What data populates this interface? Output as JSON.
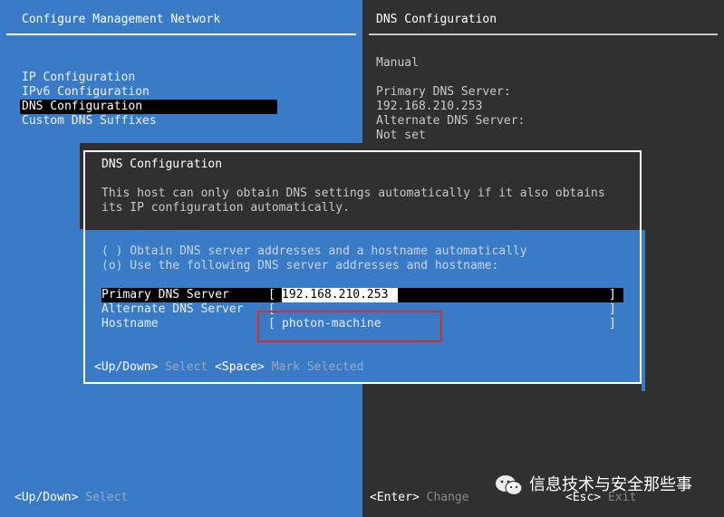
{
  "left_panel": {
    "title": "Configure Management Network",
    "menu": [
      {
        "label": "IP Configuration",
        "selected": false
      },
      {
        "label": "IPv6 Configuration",
        "selected": false
      },
      {
        "label": "DNS Configuration",
        "selected": true
      },
      {
        "label": "Custom DNS Suffixes",
        "selected": false
      }
    ],
    "footer_key": "<Up/Down>",
    "footer_action": "Select"
  },
  "right_panel": {
    "title": "DNS Configuration",
    "mode": "Manual",
    "primary_label": "Primary DNS Server:",
    "primary_value": "192.168.210.253",
    "alternate_label": "Alternate DNS Server:",
    "alternate_value": "Not set",
    "footer_enter_key": "<Enter>",
    "footer_enter_action": "Change",
    "footer_esc_key": "<Esc>",
    "footer_esc_action": "Exit"
  },
  "dialog": {
    "title": "DNS Configuration",
    "description_line1": "This host can only obtain DNS settings automatically if it also obtains",
    "description_line2": "its IP configuration automatically.",
    "option_auto": "( ) Obtain DNS server addresses and a hostname automatically",
    "option_manual": "(o) Use the following DNS server addresses and hostname:",
    "fields": {
      "primary_label": "Primary DNS Server",
      "primary_value": "192.168.210.253",
      "alternate_label": "Alternate DNS Server",
      "alternate_value": "",
      "hostname_label": "Hostname",
      "hostname_value": "photon-machine"
    },
    "bracket_open": "[",
    "bracket_close": "]",
    "footer_updown_key": "<Up/Down>",
    "footer_updown_action": "Select",
    "footer_space_key": "<Space>",
    "footer_space_action": "Mark Selected"
  },
  "watermark": {
    "text": "信息技术与安全那些事",
    "icon": "wechat-icon"
  },
  "colors": {
    "blue": "#3a7bc8",
    "dark": "#303030",
    "highlight": "#000000",
    "annotation_red": "#d03030"
  }
}
